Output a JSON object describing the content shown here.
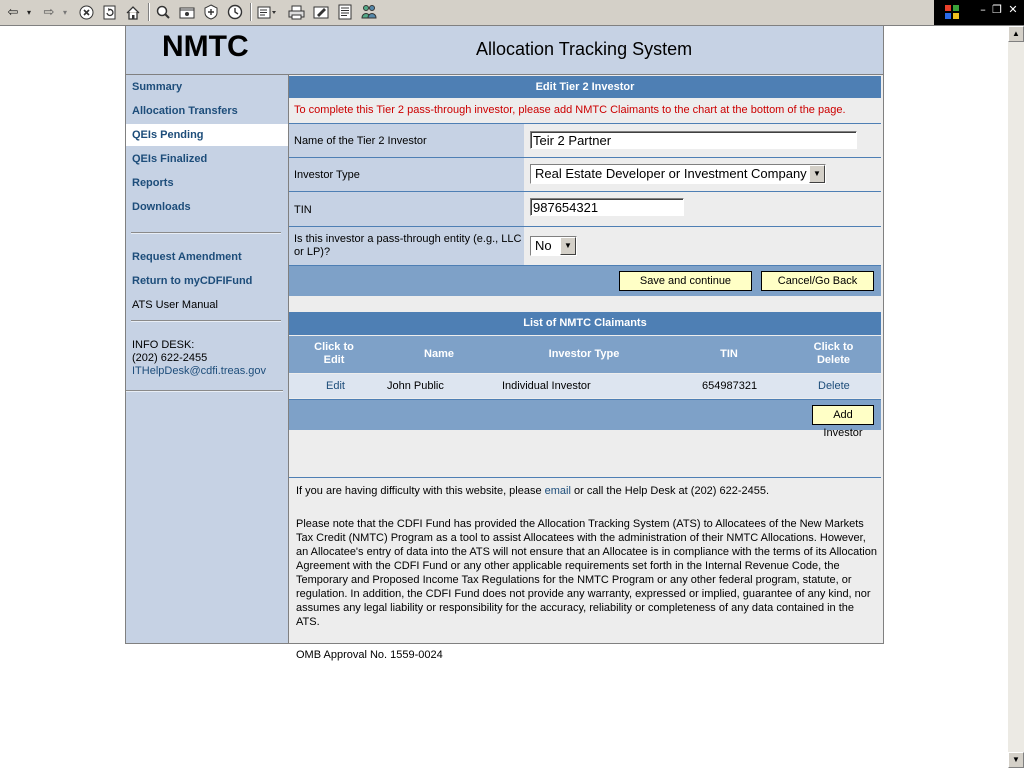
{
  "browser": {
    "buttons": [
      "back-arrow",
      "forward-arrow",
      "stop",
      "refresh",
      "home",
      "search",
      "favorites",
      "media",
      "history",
      "mail",
      "print",
      "edit",
      "discuss",
      "messenger"
    ]
  },
  "header": {
    "logo": "NMTC",
    "title": "Allocation Tracking System"
  },
  "nav": {
    "items": [
      {
        "label": "Summary"
      },
      {
        "label": "Allocation Transfers"
      },
      {
        "label": "QEIs Pending"
      },
      {
        "label": "QEIs Finalized"
      },
      {
        "label": "Reports"
      },
      {
        "label": "Downloads"
      }
    ],
    "request_amendment": "Request Amendment",
    "return_link": "Return to myCDFIFund",
    "manual": "ATS User Manual",
    "info_desk": "INFO DESK:",
    "phone": "(202) 622-2455",
    "email": "ITHelpDesk@cdfi.treas.gov"
  },
  "form": {
    "title": "Edit Tier 2 Investor",
    "instruction": "To complete this Tier 2 pass-through investor, please add NMTC Claimants to the chart at the bottom of the page.",
    "name_label": "Name of the Tier 2 Investor",
    "name_value": "Teir 2 Partner",
    "type_label": "Investor Type",
    "type_value": "Real Estate Developer or Investment Company",
    "tin_label": "TIN",
    "tin_value": "987654321",
    "passthrough_label": "Is this investor a pass-through entity (e.g., LLC or LP)?",
    "passthrough_value": "No",
    "save_label": "Save and continue",
    "cancel_label": "Cancel/Go Back"
  },
  "claimants": {
    "title": "List of NMTC Claimants",
    "columns": [
      "Click to Edit",
      "Name",
      "Investor Type",
      "TIN",
      "Click to Delete"
    ],
    "rows": [
      {
        "edit": "Edit",
        "name": "John Public",
        "type": "Individual Investor",
        "tin": "654987321",
        "delete": "Delete"
      }
    ],
    "add_label": "Add Investor"
  },
  "footer": {
    "help_pre": "If you are having difficulty with this website, please ",
    "help_link": "email",
    "help_post": " or call the Help Desk at (202) 622-2455.",
    "disclaimer": "Please note that the CDFI Fund has provided the Allocation Tracking System (ATS) to Allocatees of the New Markets Tax Credit (NMTC) Program as a tool to assist Allocatees with the administration of their NMTC Allocations. However, an Allocatee's entry of data into the ATS will not ensure that an Allocatee is in compliance with the terms of its Allocation Agreement with the CDFI Fund or any other applicable requirements set forth in the Internal Revenue Code, the Temporary and Proposed Income Tax Regulations for the NMTC Program or any other federal program, statute, or regulation. In addition, the CDFI Fund does not provide any warranty, expressed or implied, guarantee of any kind, nor assumes any legal liability or responsibility for the accuracy, reliability or completeness of any data contained in the ATS.",
    "omb": "OMB Approval No. 1559-0024"
  }
}
